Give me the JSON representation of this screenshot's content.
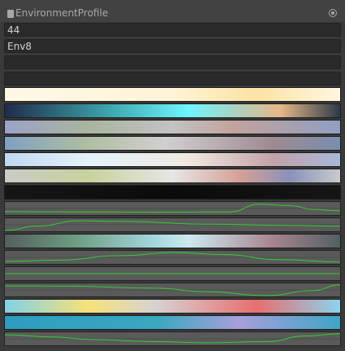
{
  "header": {
    "title": "EnvironmentProfile",
    "component_icon": "script-icon",
    "settings_icon": "settings-icon"
  },
  "fields": {
    "value": "44",
    "name": "Env8",
    "empty1": "",
    "empty2": ""
  },
  "colors": {
    "panel_bg": "#3a3a3a",
    "header_bg": "#424242",
    "field_bg": "#2a2a2a",
    "curve_bg": "#5a5a5a",
    "curve_line": "#33cc33",
    "text": "#d2d2d2"
  },
  "gradients": [
    {
      "name": "gradient-1",
      "stops": [
        "#fff8e8 0%",
        "#fff4d6 50%",
        "#fbe3a3 75%",
        "#fff6e1 100%"
      ]
    },
    {
      "name": "gradient-2",
      "stops": [
        "#1f2c4a 0%",
        "#3ea9b0 32%",
        "#6ff7ff 55%",
        "#a7d3c3 68%",
        "#e7b888 82%",
        "#2d3a48 100%"
      ]
    },
    {
      "name": "gradient-3",
      "stops": [
        "#9aa2c9 0%",
        "#a9b59e 25%",
        "#c2c2c2 50%",
        "#c3a39c 68%",
        "#8f9fc2 100%"
      ]
    },
    {
      "name": "gradient-4",
      "stops": [
        "#80a0c2 0%",
        "#afbfa2 25%",
        "#d2cfcf 48%",
        "#9e8a90 80%",
        "#778faf 100%"
      ]
    },
    {
      "name": "gradient-5",
      "stops": [
        "#c2d8f0 0%",
        "#e4f3fa 25%",
        "#f0e8e0 55%",
        "#c3a2a8 80%",
        "#a7b8d8 100%"
      ]
    },
    {
      "name": "gradient-6",
      "stops": [
        "#c8cbc8 0%",
        "#c7d29c 25%",
        "#e6e6e6 50%",
        "#d5a197 70%",
        "#8a91bb 85%",
        "#c8cbcb 100%"
      ]
    },
    {
      "name": "gradient-7",
      "stops": [
        "#151515 0%",
        "#0b0b0b 50%",
        "#151515 100%"
      ]
    },
    {
      "name": "gradient-8",
      "stops": [
        "#555f5f 0%",
        "#6a9a7f 20%",
        "#a7d7df 45%",
        "#cde9ef 55%",
        "#a7848f 80%",
        "#525f63 100%"
      ]
    },
    {
      "name": "gradient-9",
      "stops": [
        "#83d1e6 0%",
        "#f6e27a 25%",
        "#d7d2d2 45%",
        "#e86f6f 75%",
        "#8bd3ef 100%"
      ]
    },
    {
      "name": "gradient-10",
      "stops": [
        "#2e9cc0 0%",
        "#3aa8bf 45%",
        "#a79fdc 70%",
        "#3ea5c6 100%"
      ]
    }
  ],
  "curves": [
    {
      "name": "curve-1",
      "points": [
        [
          0,
          0.78
        ],
        [
          0.45,
          0.82
        ],
        [
          0.67,
          0.8
        ],
        [
          0.76,
          0.12
        ],
        [
          0.85,
          0.25
        ],
        [
          0.92,
          0.58
        ],
        [
          1,
          0.7
        ]
      ]
    },
    {
      "name": "curve-2",
      "points": [
        [
          0,
          1.0
        ],
        [
          0.1,
          0.6
        ],
        [
          0.22,
          0.15
        ],
        [
          0.35,
          0.2
        ],
        [
          0.6,
          0.45
        ],
        [
          0.85,
          0.55
        ],
        [
          1,
          0.62
        ]
      ]
    },
    {
      "name": "curve-3",
      "points": [
        [
          0,
          0.85
        ],
        [
          0.15,
          0.75
        ],
        [
          0.35,
          0.35
        ],
        [
          0.5,
          0.08
        ],
        [
          0.65,
          0.25
        ],
        [
          0.82,
          0.7
        ],
        [
          1,
          0.9
        ]
      ]
    },
    {
      "name": "curve-4",
      "points": [
        [
          0,
          0.5
        ],
        [
          0.5,
          0.5
        ],
        [
          1,
          0.5
        ]
      ]
    },
    {
      "name": "curve-5",
      "points": [
        [
          0,
          0.15
        ],
        [
          0.2,
          0.18
        ],
        [
          0.45,
          0.35
        ],
        [
          0.6,
          0.65
        ],
        [
          0.78,
          1.0
        ],
        [
          0.92,
          0.55
        ],
        [
          1,
          0.05
        ]
      ]
    },
    {
      "name": "curve-6",
      "points": [
        [
          0,
          0.15
        ],
        [
          0.15,
          0.35
        ],
        [
          0.25,
          0.55
        ],
        [
          0.45,
          0.75
        ],
        [
          0.6,
          0.85
        ],
        [
          0.78,
          0.75
        ],
        [
          0.9,
          0.25
        ],
        [
          1,
          0.05
        ]
      ]
    }
  ]
}
